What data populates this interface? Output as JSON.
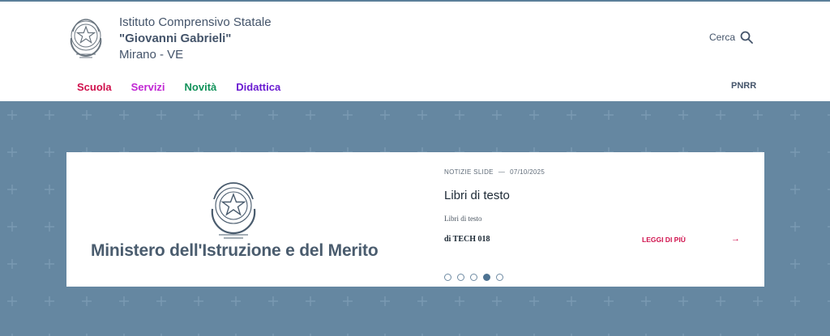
{
  "header": {
    "school_line1": "Istituto Comprensivo Statale",
    "school_line2": "\"Giovanni Gabrieli\"",
    "school_line3": "Mirano - VE",
    "search_label": "Cerca",
    "search_icon": "search-icon",
    "emblem_icon": "italian-republic-emblem-icon"
  },
  "nav": {
    "items": [
      {
        "label": "Scuola",
        "color": "#d0104c"
      },
      {
        "label": "Servizi",
        "color": "#c026d3"
      },
      {
        "label": "Novità",
        "color": "#11925a"
      },
      {
        "label": "Didattica",
        "color": "#6a1bd1"
      }
    ],
    "pnrr": "PNRR"
  },
  "hero": {
    "background_color": "#6587a1",
    "slide": {
      "ministry": "Ministero dell'Istruzione e del Merito",
      "category": "NOTIZIE SLIDE",
      "separator": "—",
      "date": "07/10/2025",
      "title": "Libri di testo",
      "description": "Libri di testo",
      "author": "di TECH 018",
      "read_more": "LEGGI DI PIÙ",
      "arrow": "→"
    },
    "carousel": {
      "total": 5,
      "active_index": 3
    }
  }
}
